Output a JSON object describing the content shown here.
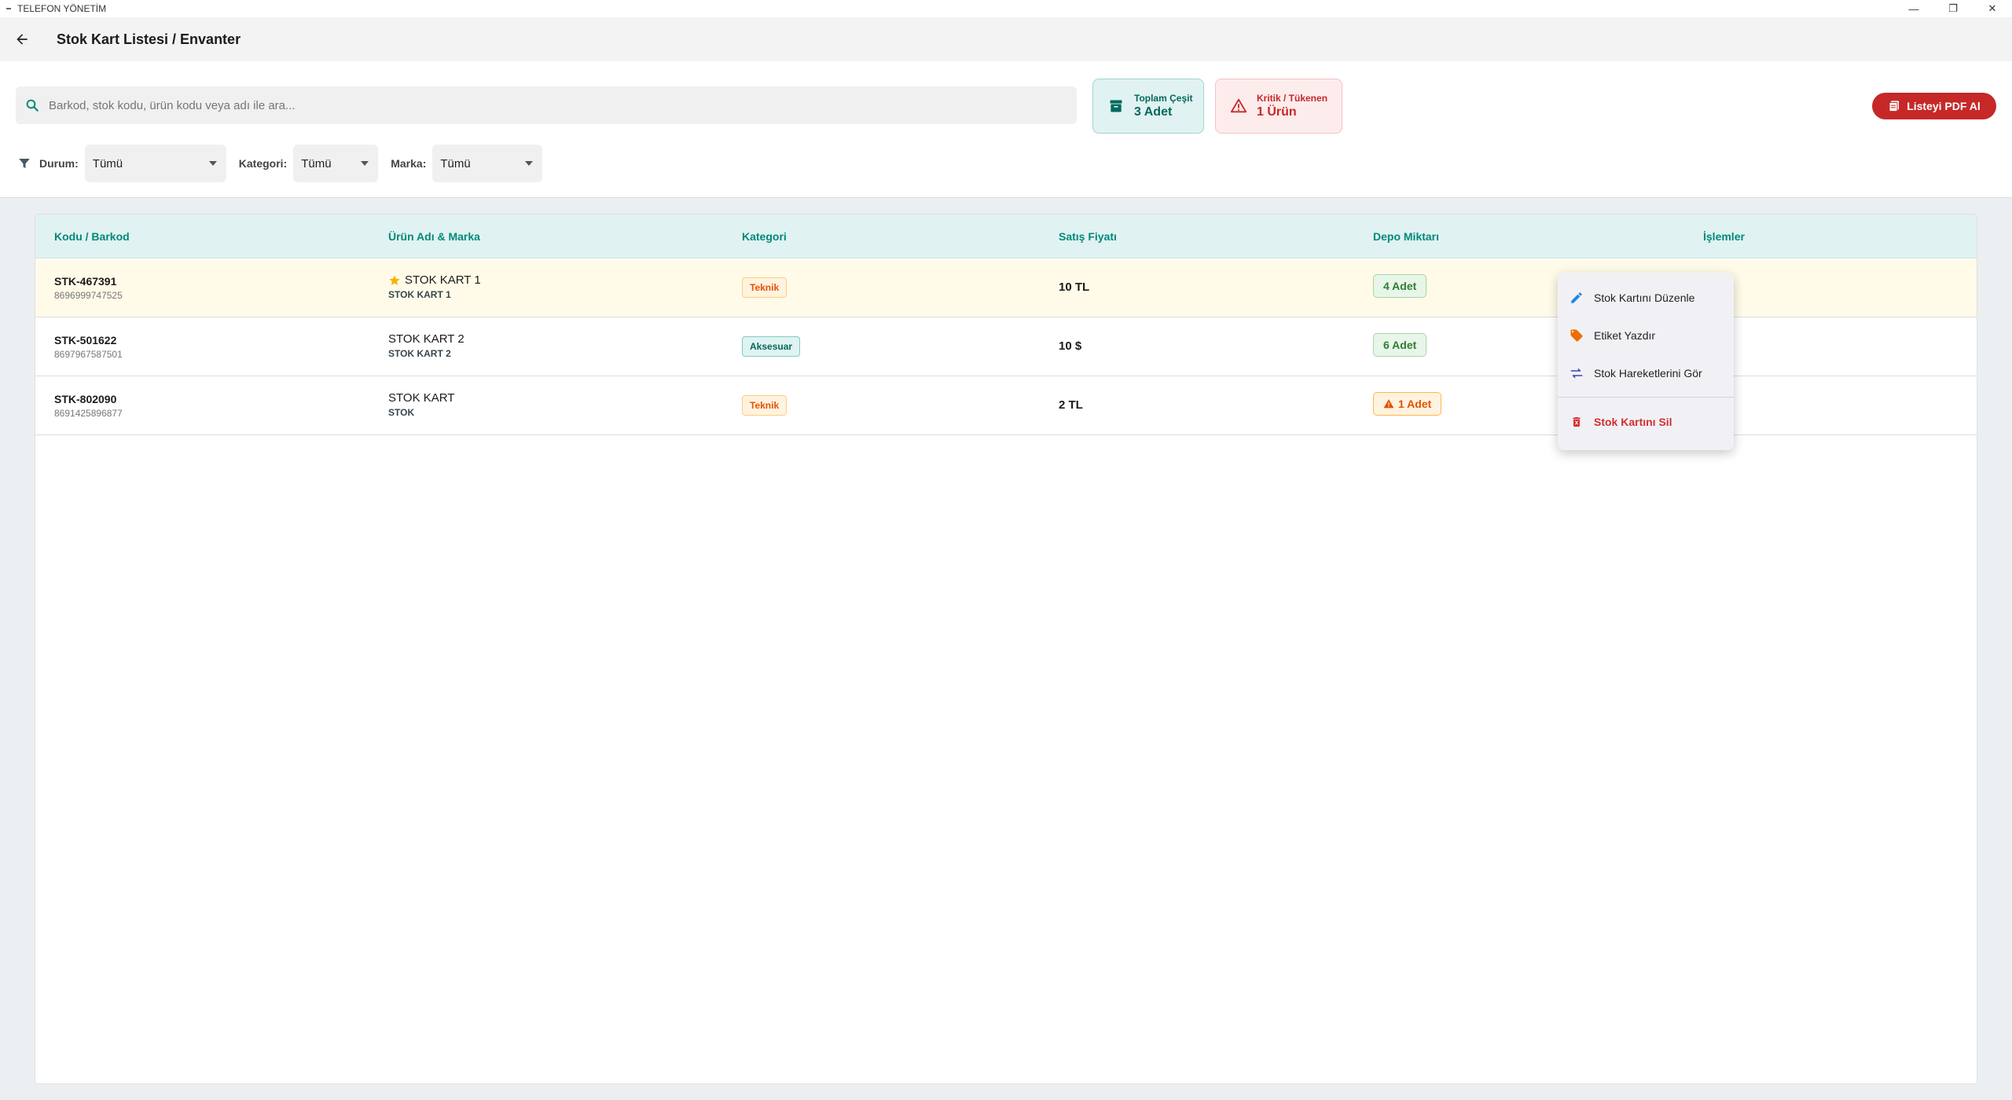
{
  "window": {
    "title": "TELEFON YÖNETİM",
    "controls": {
      "minimize": "—",
      "restore": "❐",
      "close": "✕"
    }
  },
  "header": {
    "title": "Stok Kart Listesi / Envanter",
    "back_icon": "arrow-left-icon"
  },
  "search": {
    "placeholder": "Barkod, stok kodu, ürün kodu veya adı ile ara...",
    "value": ""
  },
  "stats": {
    "total": {
      "label": "Toplam Çeşit",
      "value": "3 Adet",
      "icon": "archive-icon"
    },
    "critical": {
      "label": "Kritik / Tükenen",
      "value": "1 Ürün",
      "icon": "warning-icon"
    }
  },
  "pdf_button": {
    "label": "Listeyi PDF Al",
    "icon": "pdf-icon"
  },
  "filters": {
    "status": {
      "label": "Durum:",
      "value": "Tümü"
    },
    "category": {
      "label": "Kategori:",
      "value": "Tümü"
    },
    "brand": {
      "label": "Marka:",
      "value": "Tümü"
    }
  },
  "table": {
    "columns": [
      "Kodu / Barkod",
      "Ürün Adı & Marka",
      "Kategori",
      "Satış Fiyatı",
      "Depo Miktarı",
      "İşlemler"
    ],
    "rows": [
      {
        "code": "STK-467391",
        "barcode": "8696999747525",
        "name": "STOK KART 1",
        "brand": "STOK KART 1",
        "category": "Teknik",
        "price": "10 TL",
        "stock": "4 Adet",
        "favorite": true,
        "critical": false
      },
      {
        "code": "STK-501622",
        "barcode": "8697967587501",
        "name": "STOK KART 2",
        "brand": "STOK KART 2",
        "category": "Aksesuar",
        "price": "10 $",
        "stock": "6 Adet",
        "favorite": false,
        "critical": false
      },
      {
        "code": "STK-802090",
        "barcode": "8691425896877",
        "name": "STOK KART",
        "brand": "STOK",
        "category": "Teknik",
        "price": "2 TL",
        "stock": "1 Adet",
        "favorite": false,
        "critical": true
      }
    ]
  },
  "context_menu": {
    "items": [
      {
        "label": "Stok Kartını Düzenle",
        "icon": "edit-icon"
      },
      {
        "label": "Etiket Yazdır",
        "icon": "tag-icon"
      },
      {
        "label": "Stok Hareketlerini Gör",
        "icon": "swap-icon"
      },
      {
        "label": "Stok Kartını Sil",
        "icon": "trash-icon"
      }
    ]
  },
  "colors": {
    "accent": "#00897b",
    "danger": "#c62828",
    "warning": "#e65100",
    "success": "#2e7d32"
  }
}
